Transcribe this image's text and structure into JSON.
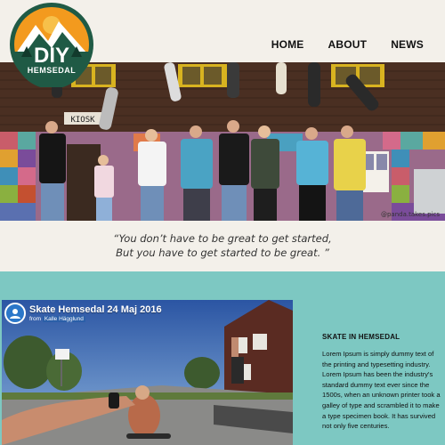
{
  "logo": {
    "line1": "DIY",
    "line2": "HEMSEDAL"
  },
  "nav": {
    "items": [
      "HOME",
      "ABOUT",
      "NEWS"
    ]
  },
  "hero": {
    "sign": "KIOSK",
    "credit": "@panda.takes.pics"
  },
  "quote": {
    "line1": "“You don’t have to be great to get started,",
    "line2": "But you have to get started to be great. ”"
  },
  "video": {
    "title": "Skate Hemsedal 24 Maj 2016",
    "from_label": "from",
    "author": "Kalle Hägglund"
  },
  "aside": {
    "title": "SKATE IN HEMSEDAL",
    "body": "Lorem Ipsum is simply dummy text of the printing and typesetting industry. Lorem Ipsum has been the industry's standard dummy text ever since the 1500s, when an unknown printer took a galley of type and scrambled it to make a type specimen book. It has survived not only five centuries."
  },
  "colors": {
    "teal": "#7dc8c2",
    "logo_green": "#1f5a45",
    "logo_orange": "#f39a1e",
    "page_bg": "#f3f0ea"
  }
}
